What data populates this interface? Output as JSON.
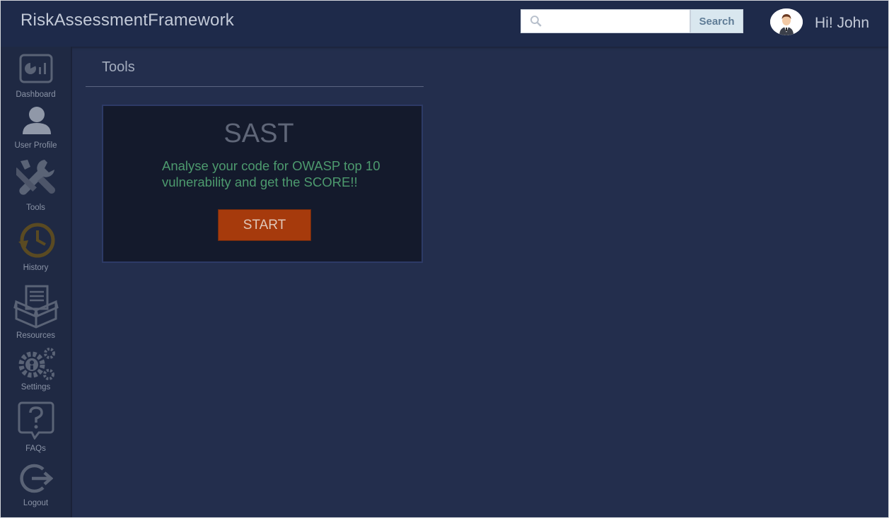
{
  "app": {
    "title": "RiskAssessmentFramework"
  },
  "header": {
    "search_placeholder": "",
    "search_value": "",
    "search_button": "Search",
    "greeting": "Hi! John",
    "avatar_icon": "user-avatar-icon"
  },
  "sidebar": {
    "items": [
      {
        "label": "Dashboard",
        "icon": "dashboard-icon"
      },
      {
        "label": "User Profile",
        "icon": "user-icon"
      },
      {
        "label": "Tools",
        "icon": "tools-icon"
      },
      {
        "label": "History",
        "icon": "history-icon"
      },
      {
        "label": "Resources",
        "icon": "resources-icon"
      },
      {
        "label": "Settings",
        "icon": "settings-icon"
      },
      {
        "label": "FAQs",
        "icon": "faq-icon"
      },
      {
        "label": "Logout",
        "icon": "logout-icon"
      }
    ]
  },
  "main": {
    "section_title": "Tools",
    "card": {
      "title": "SAST",
      "description": "Analyse your code for OWASP top 10 vulnerability and get the SCORE!!",
      "button": "START"
    }
  },
  "colors": {
    "background": "#232e4d",
    "topbar": "#1e2a4a",
    "sidebar": "#1f2943",
    "card": "#141a2c",
    "accent_text": "#4d9a6e",
    "start_button": "#a63a0c"
  }
}
